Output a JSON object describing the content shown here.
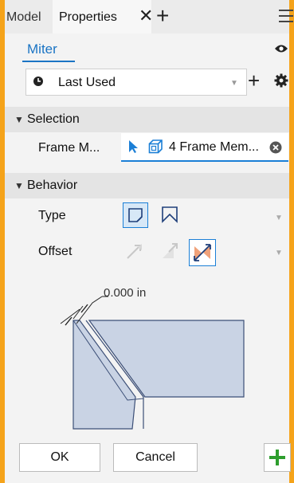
{
  "tabs": {
    "model": "Model",
    "properties": "Properties"
  },
  "header": {
    "title": "Miter"
  },
  "preset": {
    "value": "Last Used"
  },
  "sections": {
    "selection": "Selection",
    "behavior": "Behavior"
  },
  "selection": {
    "frame_label": "Frame M...",
    "frame_value": "4 Frame Mem..."
  },
  "behavior": {
    "type_label": "Type",
    "offset_label": "Offset"
  },
  "diagram": {
    "dimension": "0.000 in"
  },
  "buttons": {
    "ok": "OK",
    "cancel": "Cancel"
  },
  "colors": {
    "accent": "#1b7fd6",
    "apply_green": "#2e9e2e",
    "offset_orange": "#f0a27a",
    "frame_strip": "#f5a31a"
  }
}
